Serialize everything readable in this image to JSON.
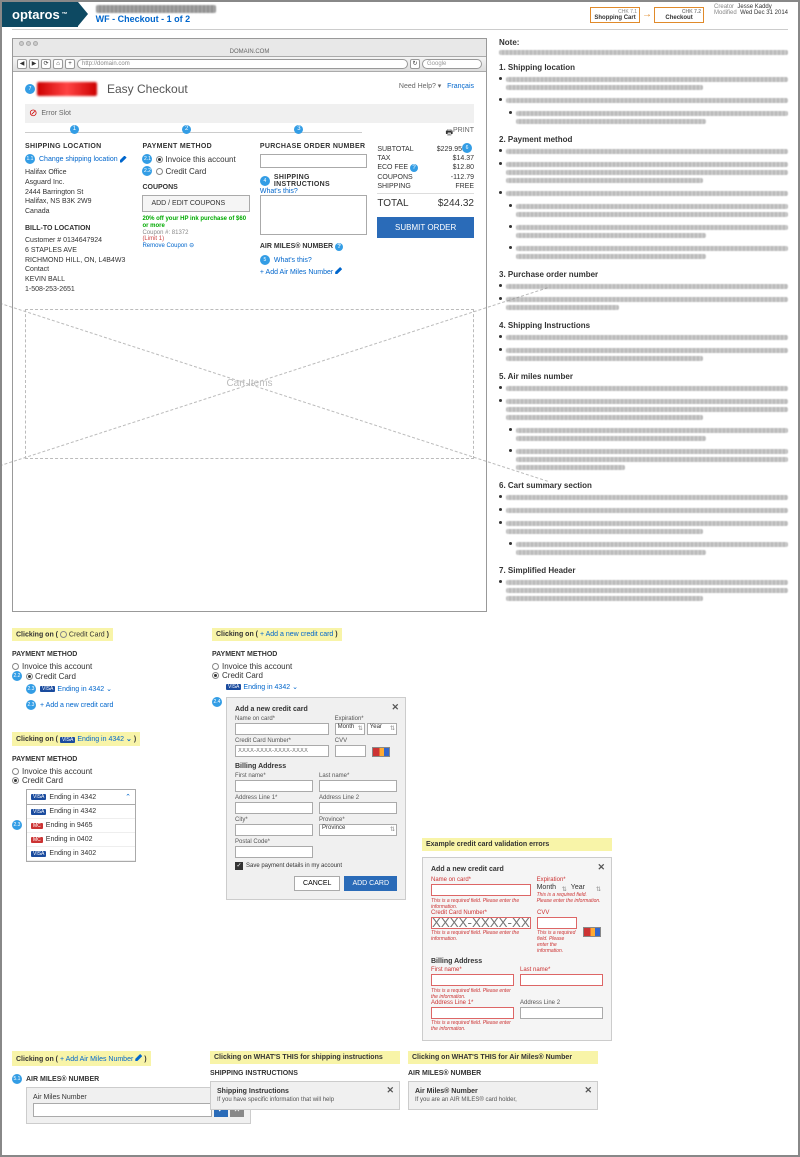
{
  "header": {
    "logo": "optaros",
    "wf_title": "WF - Checkout - 1 of 2",
    "step1_code": "CHK 7.1",
    "step1_name": "Shopping Cart",
    "step2_code": "CHK 7.2",
    "step2_name": "Checkout",
    "creator_lbl": "Creator",
    "creator": "Jesse Kaddy",
    "modified_lbl": "Modified",
    "modified": "Wed Dec 31 2014"
  },
  "browser": {
    "domain_lbl": "DOMAIN.COM",
    "url": "http://domain.com",
    "search_ph": "Google"
  },
  "page": {
    "title": "Easy Checkout",
    "help": "Need Help?",
    "lang": "Français",
    "err_slot": "Error Slot",
    "print": "PRINT",
    "shipping_loc": "SHIPPING LOCATION",
    "change_loc": "Change shipping location",
    "addr": [
      "Halifax Office",
      "Asguard Inc.",
      "2444 Barrington St",
      "Halifax, NS B3K 2W9",
      "Canada"
    ],
    "billto": "BILL-TO LOCATION",
    "bill_addr": [
      "Customer # 0134647924",
      "6 STAPLES AVE",
      "RICHMOND HILL, ON, L4B4W3",
      "Contact",
      "KEVIN BALL",
      "1-508-253-2651"
    ],
    "payment": "PAYMENT METHOD",
    "invoice": "Invoice this account",
    "cc": "Credit Card",
    "coupons_h": "COUPONS",
    "coupon_btn": "ADD / EDIT COUPONS",
    "coupon_txt": "20% off your HP ink purchase of $60 or more",
    "coupon_num": "Coupon #: 81372",
    "coupon_limit": "(Limit 1)",
    "coupon_remove": "Remove Coupon",
    "po": "PURCHASE ORDER NUMBER",
    "instr": "SHIPPING INSTRUCTIONS",
    "whats": "What's this?",
    "airmiles": "AIR MILES® NUMBER",
    "add_am": "Add Air Miles Number",
    "cart_ph": "Cart Items",
    "summary": {
      "subtotal_lbl": "SUBTOTAL",
      "subtotal": "$229.95",
      "tax_lbl": "TAX",
      "tax": "$14.37",
      "eco_lbl": "ECO FEE",
      "eco": "$12.80",
      "coupons_lbl": "COUPONS",
      "coupons": "-112.79",
      "shipping_lbl": "SHIPPING",
      "shipping": "FREE",
      "total_lbl": "TOTAL",
      "total": "$244.32",
      "submit": "SUBMIT ORDER"
    }
  },
  "notes": {
    "note_lbl": "Note:",
    "sections_titles": {
      "s1": "1. Shipping location",
      "s2": "2. Payment method",
      "s3": "3. Purchase order number",
      "s4": "4. Shipping Instructions",
      "s5": "5. Air miles number",
      "s6": "6. Cart summary section",
      "s7": "7. Simplified Header"
    }
  },
  "flows": {
    "click_on": "Clicking on  (",
    "close_p": ")",
    "cc_option": "Credit Card",
    "ending": "Ending in 4342",
    "add_cc": "Add a new credit card",
    "dd_items": [
      "Ending in 4342",
      "Ending in 9465",
      "Ending in 0402",
      "Ending in 3402"
    ],
    "ccform": {
      "title": "Add a new credit card",
      "name": "Name on card*",
      "exp": "Expiration*",
      "month": "Month",
      "year": "Year",
      "ccnum": "Credit Card Number*",
      "cc_ph": "XXXX-XXXX-XXXX-XXXX",
      "cvv": "CVV",
      "billing": "Billing Address",
      "fn": "First name*",
      "ln": "Last name*",
      "a1": "Address Line 1*",
      "a2": "Address Line 2",
      "city": "City*",
      "prov": "Province*",
      "prov_ph": "Province",
      "zip": "Postal Code*",
      "save": "Save payment details in my account",
      "cancel": "CANCEL",
      "add": "ADD CARD"
    },
    "err_title": "Example credit card validation errors",
    "err_msg": "This is a required field. Please enter the information.",
    "whats_ship": "Clicking on WHAT'S THIS for shipping instructions",
    "whats_am": "Clicking on WHAT'S THIS for Air Miles® Number",
    "ship_panel_t": "Shipping Instructions",
    "ship_panel_b": "If you have specific information that will help",
    "am_panel_t": "Air Miles® Number",
    "am_panel_b": "If you are an AIR MILES® card holder,",
    "am_num_t": "AIR MILES® NUMBER",
    "am_num_lbl": "Air Miles Number"
  }
}
